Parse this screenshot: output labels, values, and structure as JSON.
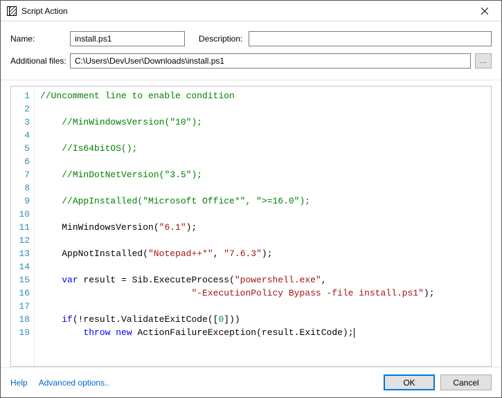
{
  "window": {
    "title": "Script Action"
  },
  "form": {
    "name_label": "Name:",
    "name_value": "install.ps1",
    "desc_label": "Description:",
    "desc_value": "",
    "addl_label": "Additional files:",
    "addl_value": "C:\\Users\\DevUser\\Downloads\\install.ps1",
    "browse_label": "..."
  },
  "code_lines": [
    {
      "n": 1,
      "tokens": [
        {
          "t": "//Uncomment line to enable condition",
          "c": "c-comment"
        }
      ]
    },
    {
      "n": 2,
      "tokens": []
    },
    {
      "n": 3,
      "tokens": [
        {
          "t": "    ",
          "c": ""
        },
        {
          "t": "//MinWindowsVersion(\"10\");",
          "c": "c-comment"
        }
      ]
    },
    {
      "n": 4,
      "tokens": []
    },
    {
      "n": 5,
      "tokens": [
        {
          "t": "    ",
          "c": ""
        },
        {
          "t": "//Is64bitOS();",
          "c": "c-comment"
        }
      ]
    },
    {
      "n": 6,
      "tokens": []
    },
    {
      "n": 7,
      "tokens": [
        {
          "t": "    ",
          "c": ""
        },
        {
          "t": "//MinDotNetVersion(\"3.5\");",
          "c": "c-comment"
        }
      ]
    },
    {
      "n": 8,
      "tokens": []
    },
    {
      "n": 9,
      "tokens": [
        {
          "t": "    ",
          "c": ""
        },
        {
          "t": "//AppInstalled(\"Microsoft Office*\", \">=16.0\");",
          "c": "c-comment"
        }
      ]
    },
    {
      "n": 10,
      "tokens": []
    },
    {
      "n": 11,
      "tokens": [
        {
          "t": "    ",
          "c": ""
        },
        {
          "t": "MinWindowsVersion",
          "c": "c-fn"
        },
        {
          "t": "(",
          "c": ""
        },
        {
          "t": "\"6.1\"",
          "c": "c-str"
        },
        {
          "t": ");",
          "c": ""
        }
      ]
    },
    {
      "n": 12,
      "tokens": []
    },
    {
      "n": 13,
      "tokens": [
        {
          "t": "    ",
          "c": ""
        },
        {
          "t": "AppNotInstalled",
          "c": "c-fn"
        },
        {
          "t": "(",
          "c": ""
        },
        {
          "t": "\"Notepad++*\"",
          "c": "c-str"
        },
        {
          "t": ", ",
          "c": ""
        },
        {
          "t": "\"7.6.3\"",
          "c": "c-str"
        },
        {
          "t": ");",
          "c": ""
        }
      ]
    },
    {
      "n": 14,
      "tokens": []
    },
    {
      "n": 15,
      "tokens": [
        {
          "t": "    ",
          "c": ""
        },
        {
          "t": "var",
          "c": "c-kw"
        },
        {
          "t": " result = Sib.",
          "c": ""
        },
        {
          "t": "ExecuteProcess",
          "c": "c-fn"
        },
        {
          "t": "(",
          "c": ""
        },
        {
          "t": "\"powershell.exe\"",
          "c": "c-str"
        },
        {
          "t": ",",
          "c": ""
        }
      ]
    },
    {
      "n": 16,
      "tokens": [
        {
          "t": "                            ",
          "c": ""
        },
        {
          "t": "\"-ExecutionPolicy Bypass -file install.ps1\"",
          "c": "c-str"
        },
        {
          "t": ");",
          "c": ""
        }
      ]
    },
    {
      "n": 17,
      "tokens": []
    },
    {
      "n": 18,
      "tokens": [
        {
          "t": "    ",
          "c": ""
        },
        {
          "t": "if",
          "c": "c-kw"
        },
        {
          "t": "(!result.",
          "c": ""
        },
        {
          "t": "ValidateExitCode",
          "c": "c-fn"
        },
        {
          "t": "([",
          "c": ""
        },
        {
          "t": "0",
          "c": "c-num"
        },
        {
          "t": "]))",
          "c": ""
        }
      ]
    },
    {
      "n": 19,
      "tokens": [
        {
          "t": "        ",
          "c": ""
        },
        {
          "t": "throw",
          "c": "c-kw"
        },
        {
          "t": " ",
          "c": ""
        },
        {
          "t": "new",
          "c": "c-kw"
        },
        {
          "t": " ",
          "c": ""
        },
        {
          "t": "ActionFailureException",
          "c": "c-fn"
        },
        {
          "t": "(result.ExitCode);",
          "c": ""
        }
      ],
      "caret": true
    }
  ],
  "footer": {
    "help": "Help",
    "advanced": "Advanced options..",
    "ok": "OK",
    "cancel": "Cancel"
  }
}
